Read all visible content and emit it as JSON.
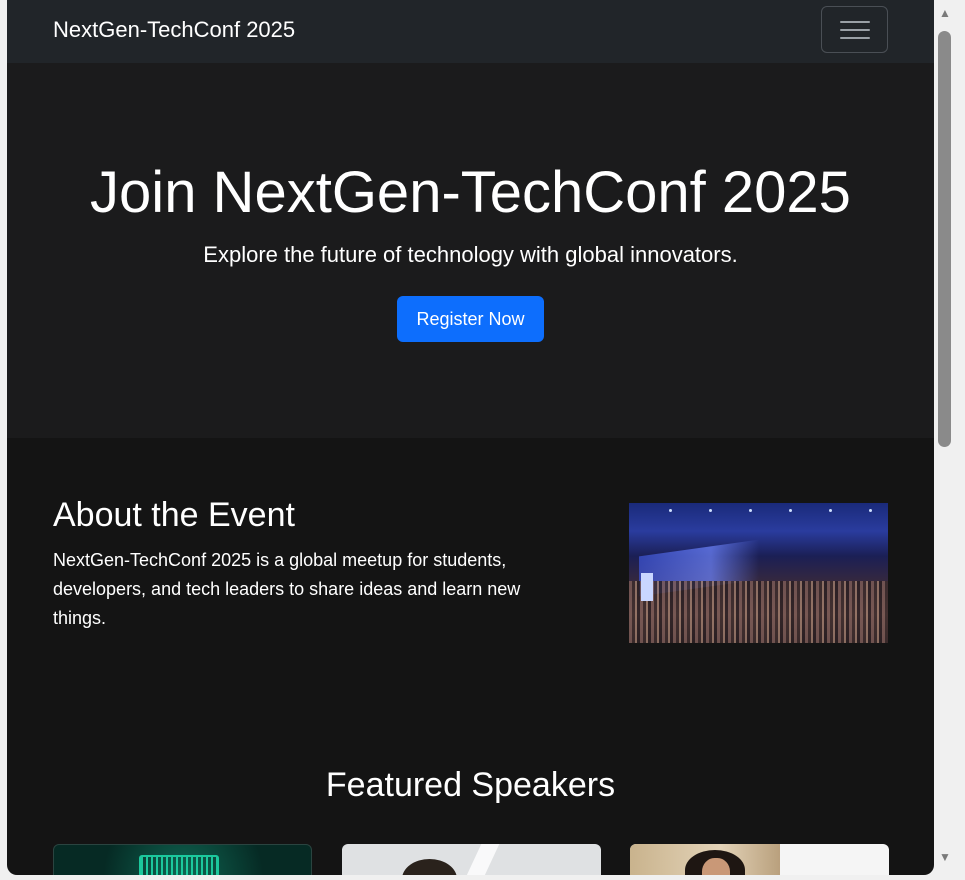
{
  "navbar": {
    "brand": "NextGen-TechConf 2025",
    "toggler_icon": "hamburger-menu-icon"
  },
  "hero": {
    "title": "Join NextGen-TechConf 2025",
    "subtitle": "Explore the future of technology with global innovators.",
    "cta_label": "Register Now"
  },
  "about": {
    "title": "About the Event",
    "text": "NextGen-TechConf 2025 is a global meetup for students, developers, and tech leaders to share ideas and learn new things."
  },
  "speakers": {
    "title": "Featured Speakers"
  },
  "scrollbar": {
    "up_icon": "scroll-up-arrow-icon",
    "down_icon": "scroll-down-arrow-icon"
  },
  "colors": {
    "navbar_bg": "#212529",
    "hero_bg": "#1b1b1c",
    "page_bg": "#141414",
    "primary_button": "#0d6efd"
  }
}
